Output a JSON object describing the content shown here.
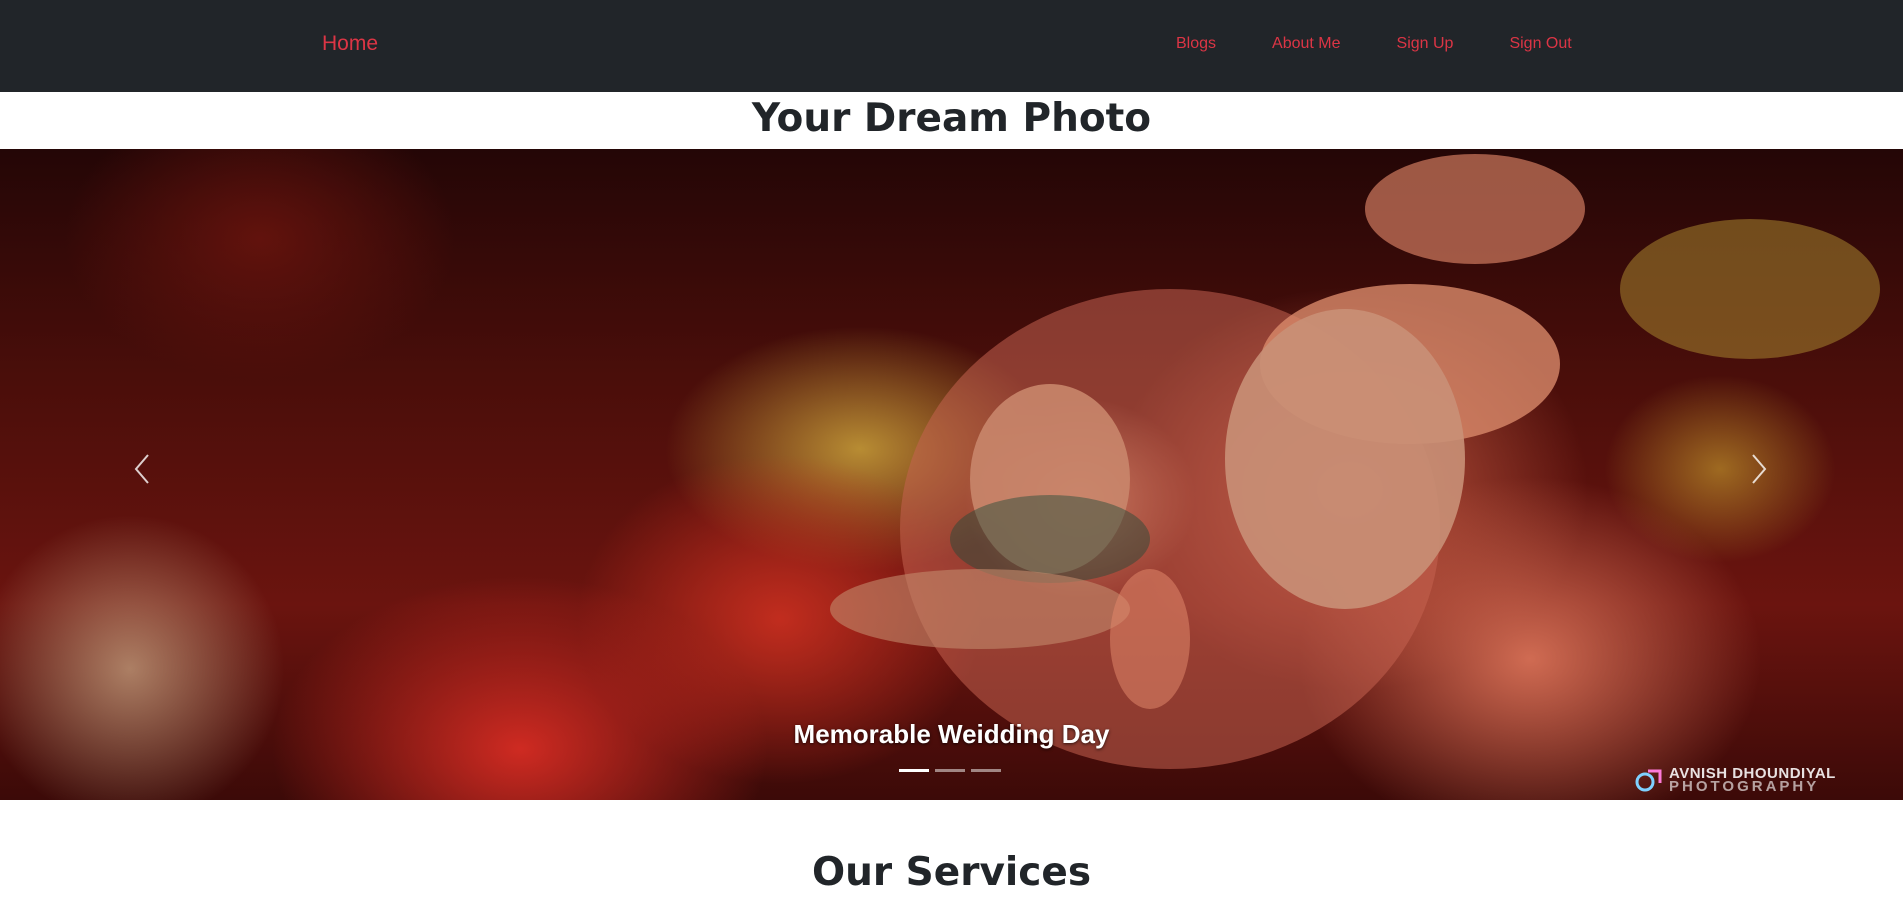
{
  "navbar": {
    "brand": "Home",
    "links": [
      "Blogs",
      "About Me",
      "Sign Up",
      "Sign Out"
    ],
    "background": "#212529",
    "link_color": "#dc3545"
  },
  "page_title": "Your Dream Photo",
  "carousel": {
    "caption": "Memorable Weidding Day",
    "slide_count": 3,
    "active_index": 0,
    "prev_icon": "chevron-left-icon",
    "next_icon": "chevron-right-icon",
    "watermark": {
      "line1": "AVNISH DHOUNDIYAL",
      "line2": "PHOTOGRAPHY"
    }
  },
  "services": {
    "title": "Our Services"
  }
}
